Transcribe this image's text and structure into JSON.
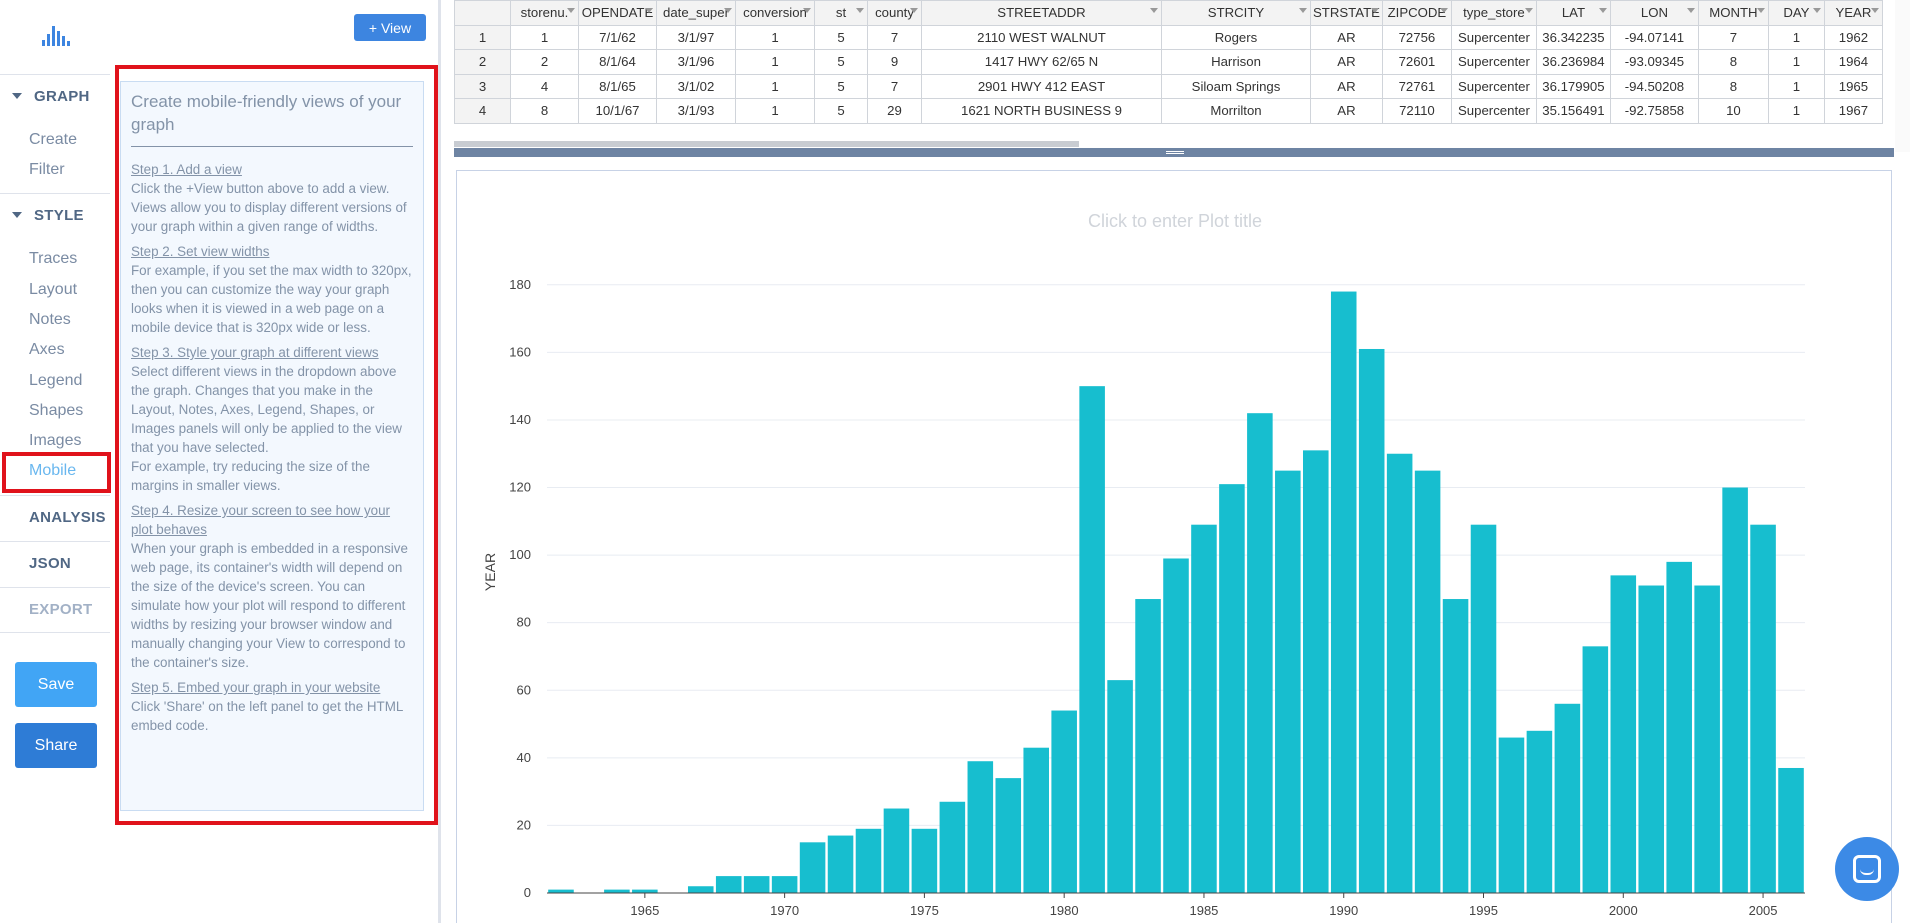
{
  "nav": {
    "graph": "GRAPH",
    "graph_items": [
      "Create",
      "Filter"
    ],
    "style": "STYLE",
    "style_items": [
      "Traces",
      "Layout",
      "Notes",
      "Axes",
      "Legend",
      "Shapes",
      "Images",
      "Mobile"
    ],
    "active_item": "Mobile",
    "analysis": "ANALYSIS",
    "json": "JSON",
    "export": "EXPORT",
    "save": "Save",
    "share": "Share"
  },
  "panel": {
    "add_view": "+ View",
    "title": "Create mobile-friendly views of your graph",
    "steps": [
      {
        "heading": "Step 1. Add a view",
        "body": "Click the +View button above to add a view. Views allow you to display different versions of your graph within a given range of widths."
      },
      {
        "heading": "Step 2. Set view widths",
        "body": "For example, if you set the max width to 320px, then you can customize the way your graph looks when it is viewed in a web page on a mobile device that is 320px wide or less."
      },
      {
        "heading": "Step 3. Style your graph at different views",
        "body": "Select different views in the dropdown above the graph. Changes that you make in the Layout, Notes, Axes, Legend, Shapes, or Images panels will only be applied to the view that you have selected.",
        "body2": "For example, try reducing the size of the margins in smaller views."
      },
      {
        "heading": "Step 4. Resize your screen to see how your plot behaves",
        "body": "When your graph is embedded in a responsive web page, its container's width will depend on the size of the device's screen. You can simulate how your plot will respond to different widths by resizing your browser window and manually changing your View to correspond to the container's size."
      },
      {
        "heading": "Step 5. Embed your graph in your website",
        "body": "Click 'Share' on the left panel to get the HTML embed code."
      }
    ]
  },
  "grid": {
    "columns": [
      "storenu.",
      "OPENDATE",
      "date_super",
      "conversion",
      "st",
      "county",
      "STREETADDR",
      "STRCITY",
      "STRSTATE",
      "ZIPCODE",
      "type_store",
      "LAT",
      "LON",
      "MONTH",
      "DAY",
      "YEAR"
    ],
    "rows": [
      [
        "1",
        "1",
        "7/1/62",
        "3/1/97",
        "1",
        "5",
        "7",
        "2110 WEST WALNUT",
        "Rogers",
        "AR",
        "72756",
        "Supercenter",
        "36.342235",
        "-94.07141",
        "7",
        "1",
        "1962"
      ],
      [
        "2",
        "2",
        "8/1/64",
        "3/1/96",
        "1",
        "5",
        "9",
        "1417 HWY 62/65 N",
        "Harrison",
        "AR",
        "72601",
        "Supercenter",
        "36.236984",
        "-93.09345",
        "8",
        "1",
        "1964"
      ],
      [
        "3",
        "4",
        "8/1/65",
        "3/1/02",
        "1",
        "5",
        "7",
        "2901 HWY 412 EAST",
        "Siloam Springs",
        "AR",
        "72761",
        "Supercenter",
        "36.179905",
        "-94.50208",
        "8",
        "1",
        "1965"
      ],
      [
        "4",
        "8",
        "10/1/67",
        "3/1/93",
        "1",
        "5",
        "29",
        "1621 NORTH BUSINESS 9",
        "Morrilton",
        "AR",
        "72110",
        "Supercenter",
        "35.156491",
        "-92.75858",
        "10",
        "1",
        "1967"
      ]
    ]
  },
  "plot": {
    "title_placeholder": "Click to enter Plot title"
  },
  "chart_data": {
    "type": "bar",
    "title": "",
    "xlabel": "",
    "ylabel": "YEAR",
    "color": "#17becf",
    "x": [
      1962,
      1963,
      1964,
      1965,
      1966,
      1967,
      1968,
      1969,
      1970,
      1971,
      1972,
      1973,
      1974,
      1975,
      1976,
      1977,
      1978,
      1979,
      1980,
      1981,
      1982,
      1983,
      1984,
      1985,
      1986,
      1987,
      1988,
      1989,
      1990,
      1991,
      1992,
      1993,
      1994,
      1995,
      1996,
      1997,
      1998,
      1999,
      2000,
      2001,
      2002,
      2003,
      2004,
      2005,
      2006
    ],
    "values": [
      1,
      0,
      1,
      1,
      0,
      2,
      5,
      5,
      5,
      15,
      17,
      19,
      25,
      19,
      27,
      39,
      34,
      43,
      54,
      150,
      63,
      87,
      99,
      109,
      121,
      142,
      125,
      131,
      178,
      161,
      130,
      125,
      87,
      109,
      46,
      48,
      56,
      73,
      94,
      91,
      98,
      91,
      120,
      109,
      37
    ],
    "xticks": [
      1965,
      1970,
      1975,
      1980,
      1985,
      1990,
      1995,
      2000,
      2005
    ],
    "yticks": [
      0,
      20,
      40,
      60,
      80,
      100,
      120,
      140,
      160,
      180
    ],
    "ylim": [
      0,
      190
    ],
    "grid": true
  }
}
